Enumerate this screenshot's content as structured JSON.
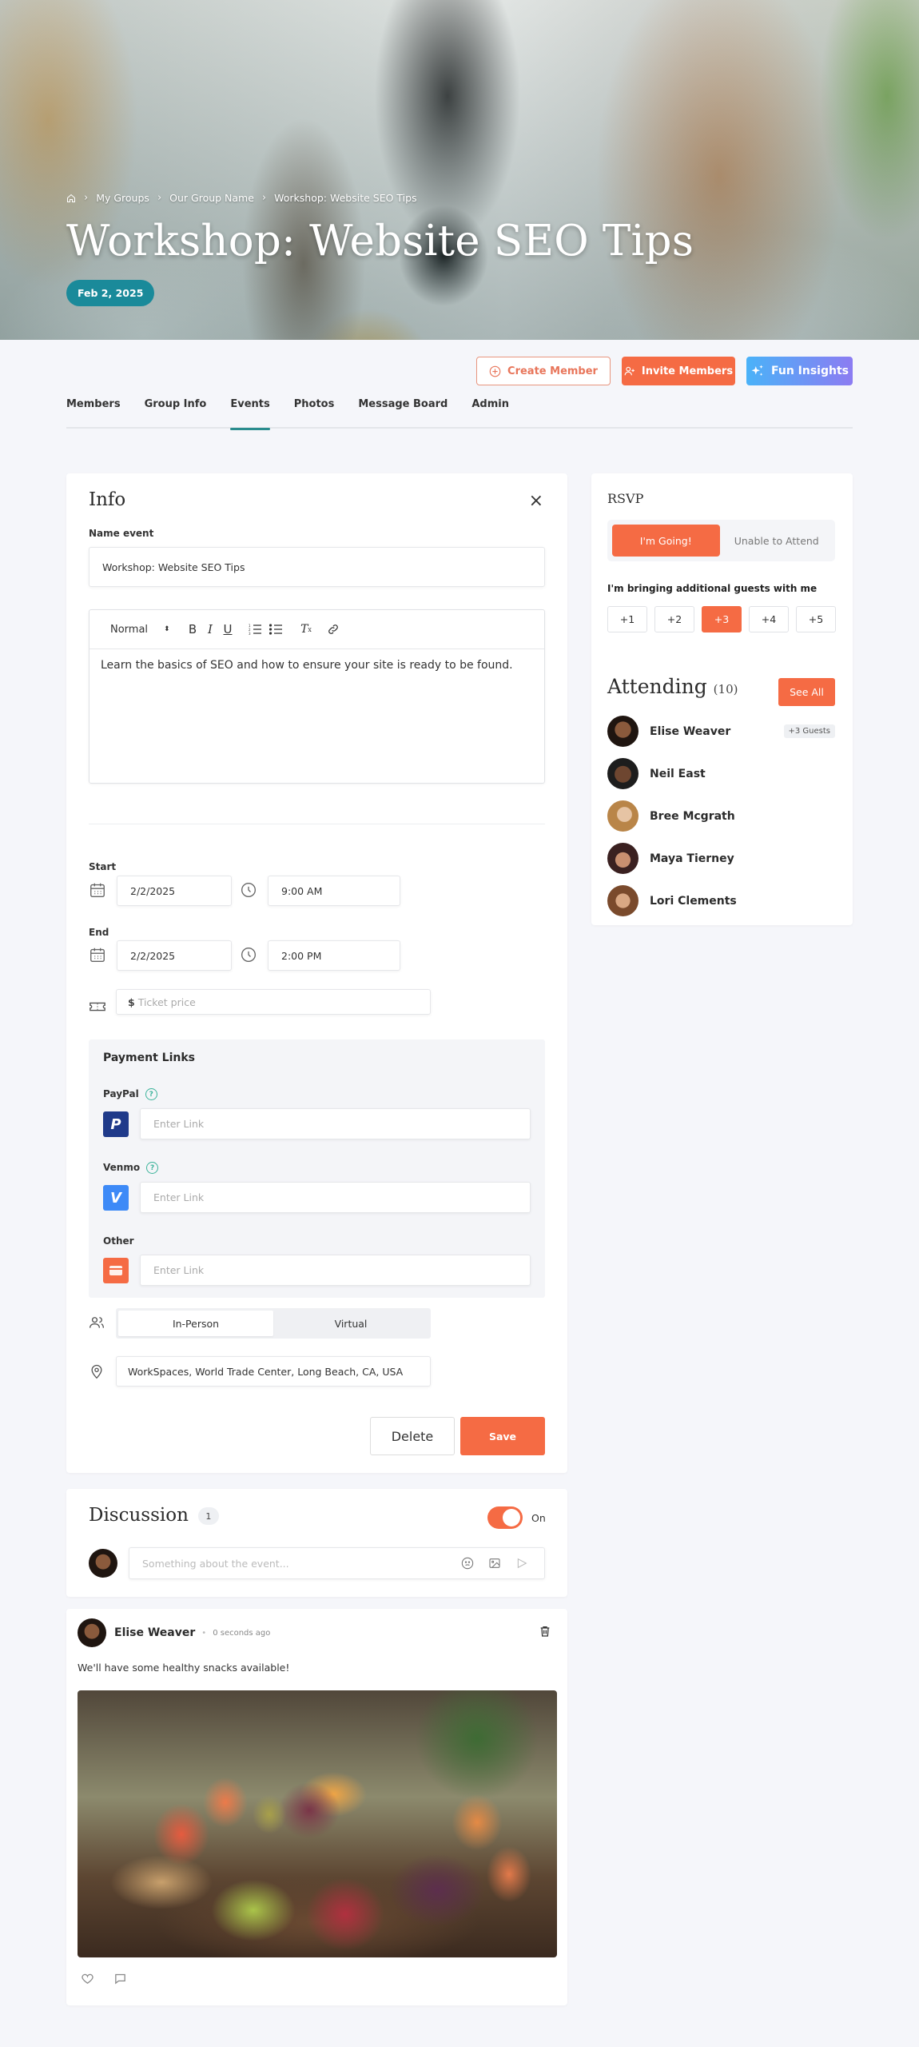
{
  "hero": {
    "breadcrumb": [
      "My Groups",
      "Our Group Name",
      "Workshop: Website SEO Tips"
    ],
    "title": "Workshop: Website SEO Tips",
    "date_badge": "Feb 2, 2025"
  },
  "actions": {
    "create_member": "Create Member",
    "invite_members": "Invite Members",
    "fun_insights": "Fun Insights"
  },
  "tabs": [
    {
      "label": "Members",
      "active": false
    },
    {
      "label": "Group Info",
      "active": false
    },
    {
      "label": "Events",
      "active": true
    },
    {
      "label": "Photos",
      "active": false
    },
    {
      "label": "Message Board",
      "active": false
    },
    {
      "label": "Admin",
      "active": false
    }
  ],
  "info": {
    "title": "Info",
    "name_label": "Name event",
    "name_value": "Workshop: Website SEO Tips",
    "editor": {
      "format_select": "Normal",
      "body": "Learn the basics of SEO and how to ensure your site is ready to be found."
    },
    "start": {
      "label": "Start",
      "date": "2/2/2025",
      "time": "9:00 AM"
    },
    "end": {
      "label": "End",
      "date": "2/2/2025",
      "time": "2:00 PM"
    },
    "ticket": {
      "prefix": "$",
      "placeholder": "Ticket price"
    },
    "payment": {
      "title": "Payment Links",
      "paypal": {
        "label": "PayPal",
        "placeholder": "Enter Link"
      },
      "venmo": {
        "label": "Venmo",
        "placeholder": "Enter Link"
      },
      "other": {
        "label": "Other",
        "placeholder": "Enter Link"
      }
    },
    "mode": {
      "options": [
        "In-Person",
        "Virtual"
      ],
      "selected": "In-Person"
    },
    "location": "WorkSpaces, World Trade Center, Long Beach, CA, USA",
    "delete_label": "Delete",
    "save_label": "Save"
  },
  "rsvp": {
    "title": "RSVP",
    "going": "I'm Going!",
    "unable": "Unable to Attend",
    "guests_label": "I'm bringing additional guests with me",
    "guest_options": [
      "+1",
      "+2",
      "+3",
      "+4",
      "+5"
    ],
    "selected_guests": "+3",
    "attending_title": "Attending",
    "attending_count": "(10)",
    "see_all": "See All",
    "attendees": [
      {
        "name": "Elise Weaver",
        "tag": "+3 Guests"
      },
      {
        "name": "Neil East",
        "tag": ""
      },
      {
        "name": "Bree Mcgrath",
        "tag": ""
      },
      {
        "name": "Maya Tierney",
        "tag": ""
      },
      {
        "name": "Lori Clements",
        "tag": ""
      }
    ]
  },
  "discussion": {
    "title": "Discussion",
    "count": "1",
    "toggle_label": "On",
    "toggle_on": true,
    "input_placeholder": "Something about the event..."
  },
  "post": {
    "author": "Elise Weaver",
    "time": "0 seconds ago",
    "text": "We'll have some healthy snacks available!"
  },
  "colors": {
    "accent": "#f56b44",
    "teal": "#1a8a9a",
    "tab_underline": "#2a8c8e",
    "paypal": "#1f3a8a",
    "venmo": "#3d8af7"
  }
}
